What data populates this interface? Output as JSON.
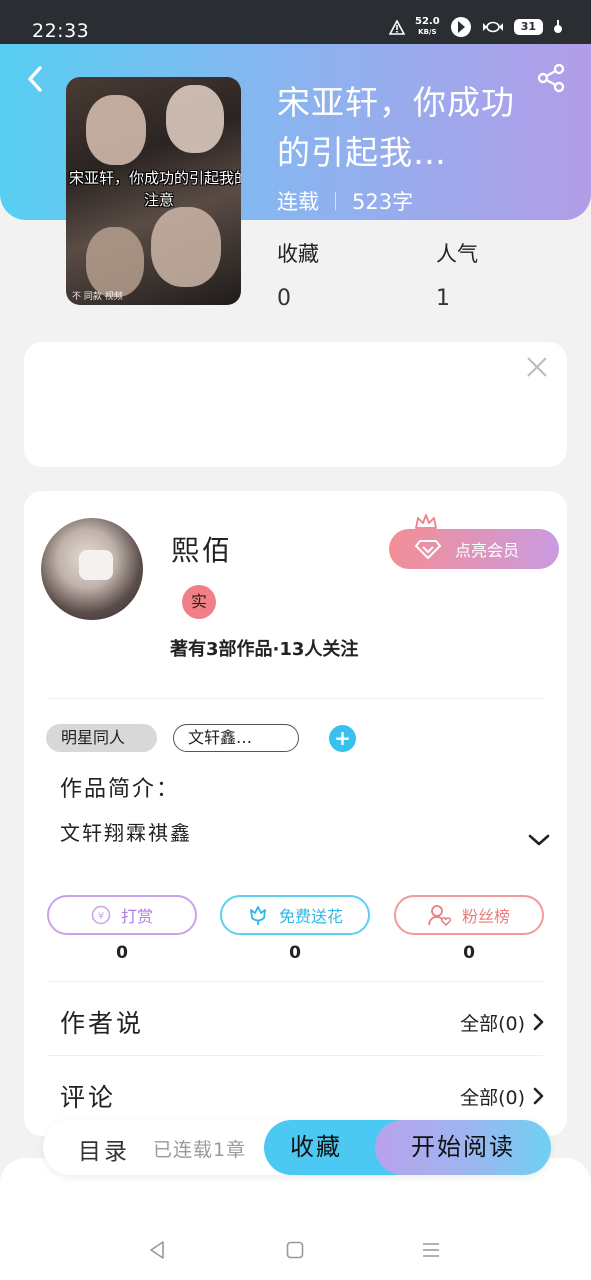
{
  "status_bar": {
    "time": "22:33",
    "net_speed": "52.0",
    "net_unit": "KB/S",
    "battery": "31"
  },
  "book": {
    "title": "宋亚轩，你成功的引起我…",
    "status": "连载",
    "word_count": "523字",
    "cover_text": "宋亚轩，你成功的引起我的注意",
    "cover_credit": "不 同款 视频",
    "favorites_label": "收藏",
    "favorites_count": "0",
    "popularity_label": "人气",
    "popularity_count": "1"
  },
  "author": {
    "name": "熙佰",
    "real_badge": "实",
    "stats": "著有3部作品·13人关注",
    "vip_button": "点亮会员",
    "tags": [
      "明星同人",
      "文轩鑫…"
    ],
    "intro_label": "作品简介：",
    "intro_text": "文轩翔霖祺鑫"
  },
  "actions": {
    "tip_label": "打赏",
    "tip_count": "0",
    "flower_label": "免费送花",
    "flower_count": "0",
    "fans_label": "粉丝榜",
    "fans_count": "0"
  },
  "sections": {
    "author_says": "作者说",
    "author_says_link": "全部(0)",
    "comments": "评论",
    "comments_link": "全部(0)"
  },
  "bottom_bar": {
    "toc_label": "目录",
    "toc_status": "已连载1章",
    "collect_label": "收藏",
    "read_label": "开始阅读"
  },
  "colors": {
    "header_start": "#58cff2",
    "header_end": "#b39de8",
    "accent_blue": "#39c0ef"
  }
}
